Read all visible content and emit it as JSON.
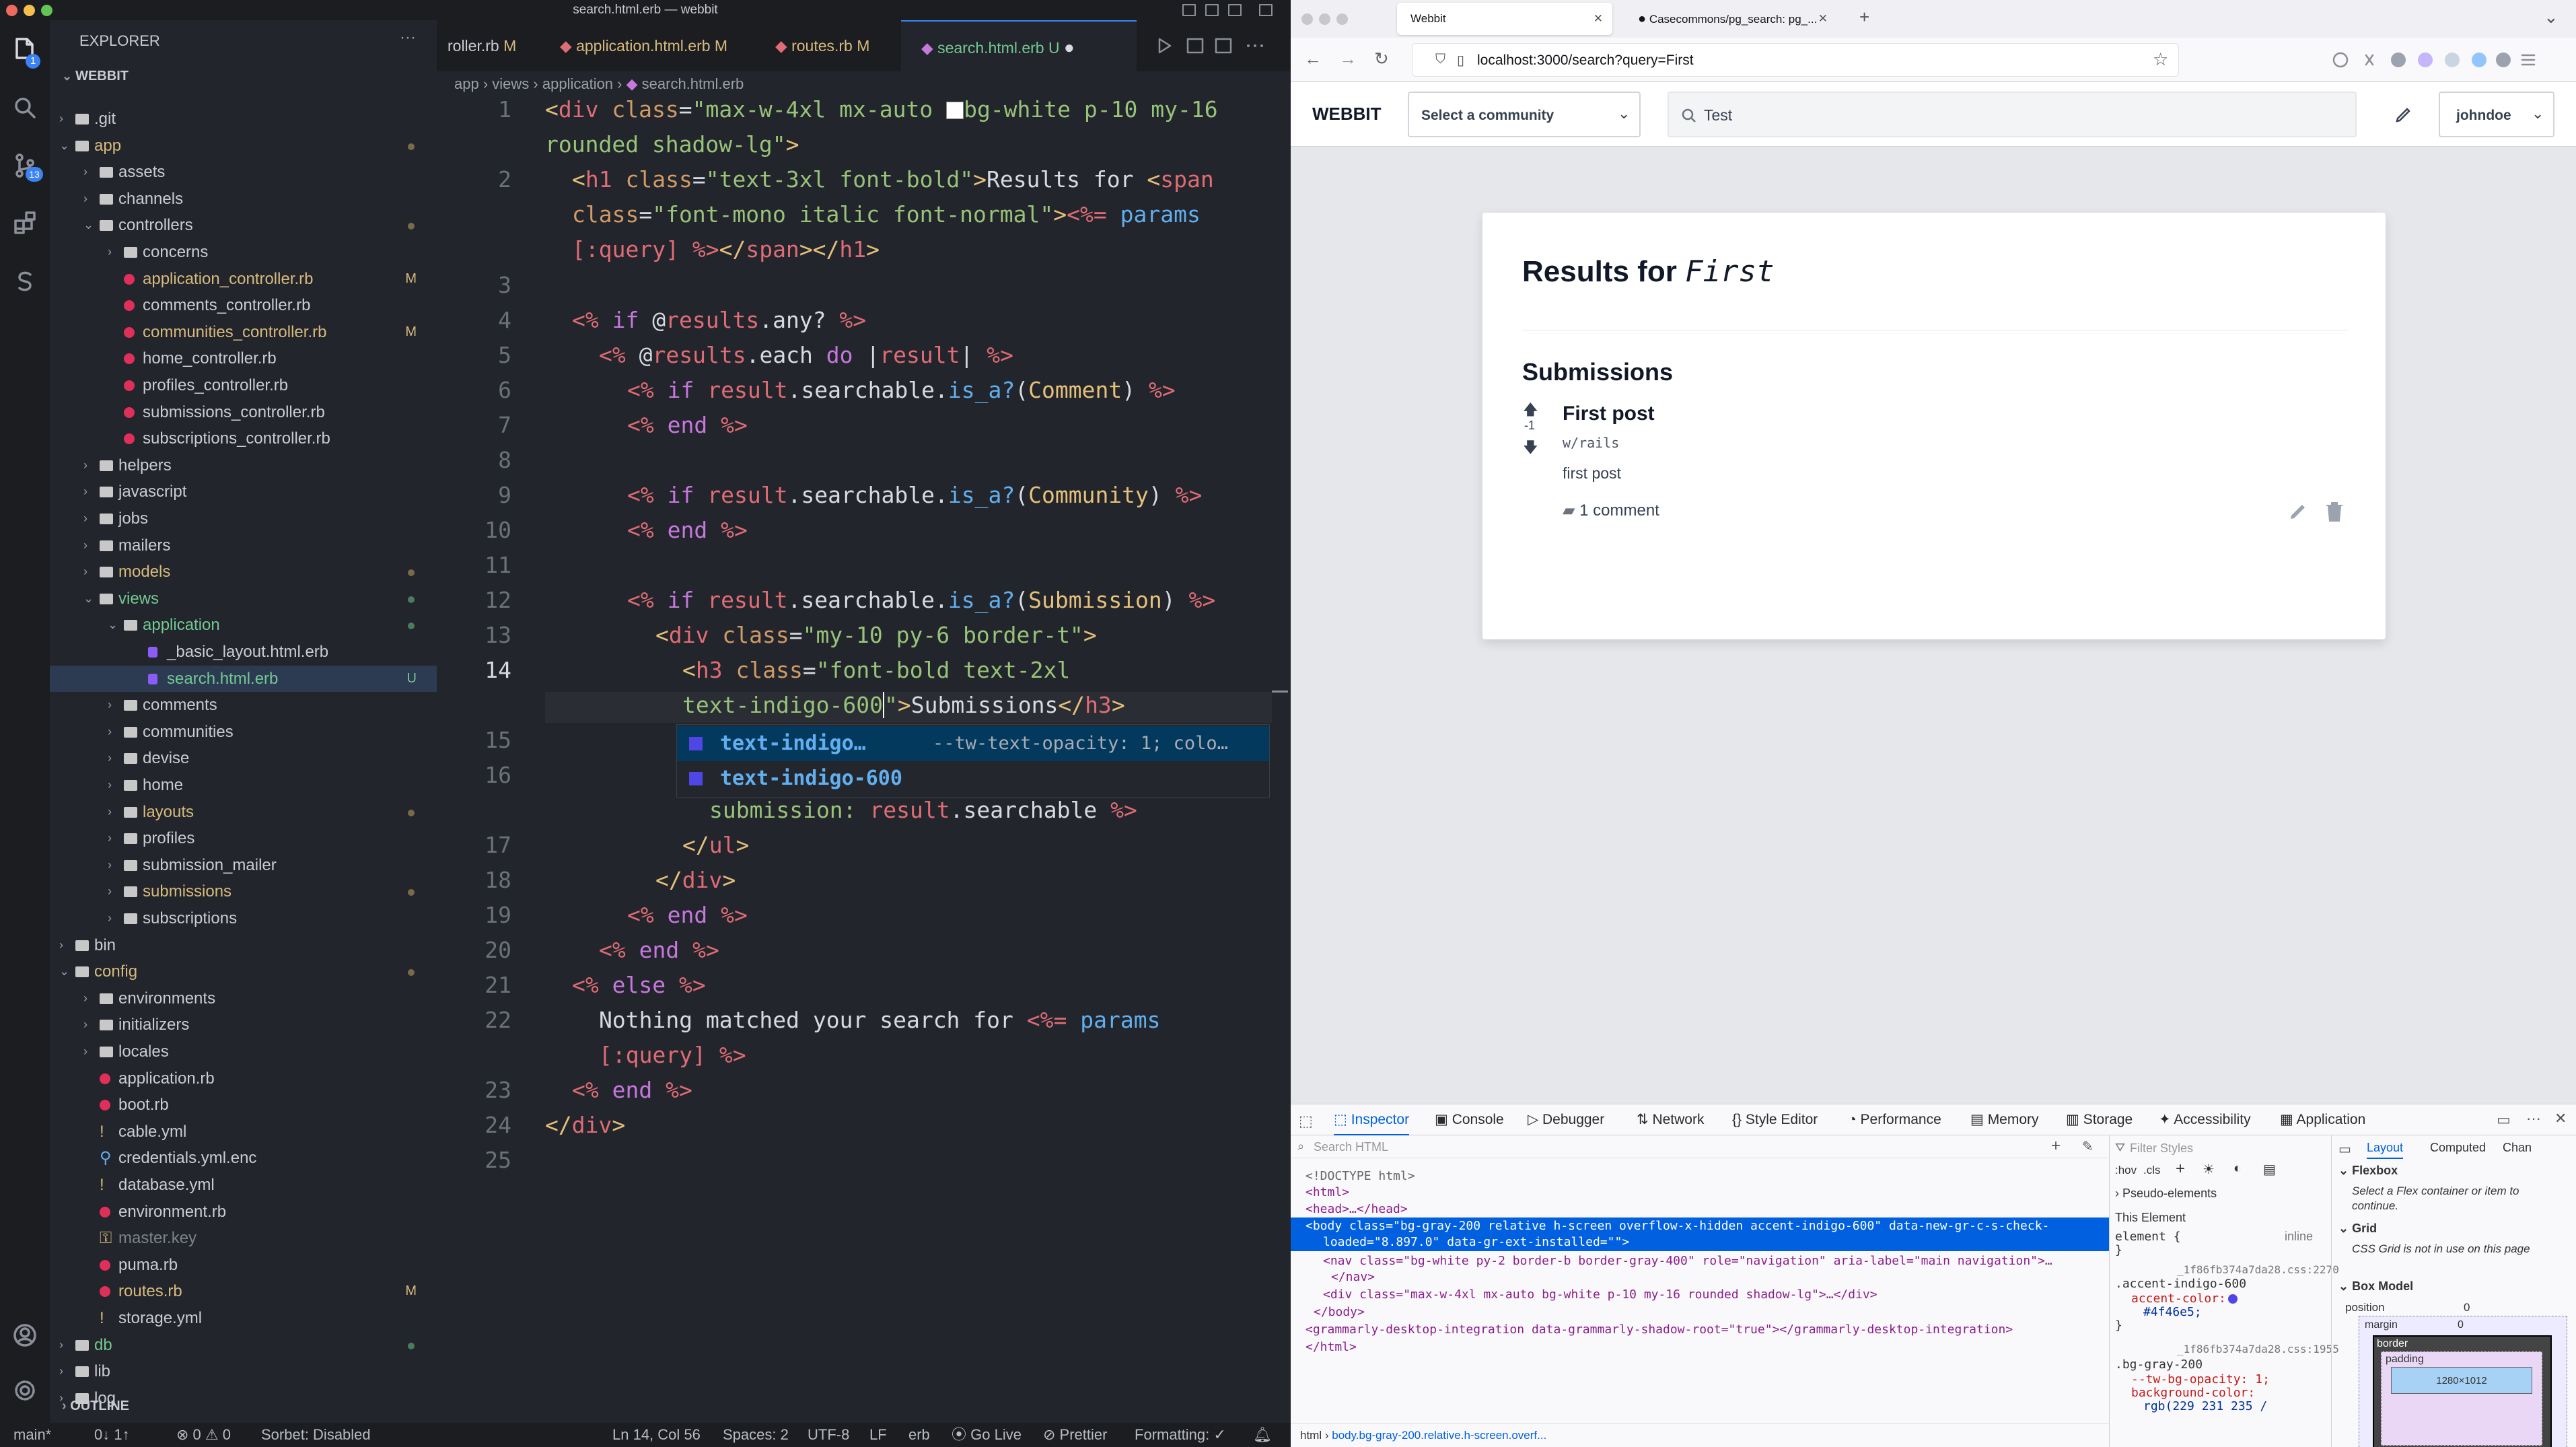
{
  "vscode": {
    "window_title": "search.html.erb — webbit",
    "explorer_title": "EXPLORER",
    "project": "WEBBIT",
    "scm_badge": "1",
    "ext_badge": "13",
    "tabs": [
      {
        "label": "roller.rb",
        "badge": "M"
      },
      {
        "label": "application.html.erb",
        "badge": "M"
      },
      {
        "label": "routes.rb",
        "badge": "M"
      },
      {
        "label": "search.html.erb",
        "badge": "U"
      }
    ],
    "breadcrumb": [
      "app",
      "views",
      "application",
      "search.html.erb"
    ],
    "tree": [
      {
        "label": ".git"
      },
      {
        "label": "app"
      },
      {
        "label": "assets"
      },
      {
        "label": "channels"
      },
      {
        "label": "controllers"
      },
      {
        "label": "concerns"
      },
      {
        "label": "application_controller.rb",
        "badge": "M"
      },
      {
        "label": "comments_controller.rb"
      },
      {
        "label": "communities_controller.rb",
        "badge": "M"
      },
      {
        "label": "home_controller.rb"
      },
      {
        "label": "profiles_controller.rb"
      },
      {
        "label": "submissions_controller.rb"
      },
      {
        "label": "subscriptions_controller.rb"
      },
      {
        "label": "helpers"
      },
      {
        "label": "javascript"
      },
      {
        "label": "jobs"
      },
      {
        "label": "mailers"
      },
      {
        "label": "models"
      },
      {
        "label": "views"
      },
      {
        "label": "application"
      },
      {
        "label": "_basic_layout.html.erb"
      },
      {
        "label": "search.html.erb",
        "badge": "U"
      },
      {
        "label": "comments"
      },
      {
        "label": "communities"
      },
      {
        "label": "devise"
      },
      {
        "label": "home"
      },
      {
        "label": "layouts"
      },
      {
        "label": "profiles"
      },
      {
        "label": "submission_mailer"
      },
      {
        "label": "submissions"
      },
      {
        "label": "subscriptions"
      },
      {
        "label": "bin"
      },
      {
        "label": "config"
      },
      {
        "label": "environments"
      },
      {
        "label": "initializers"
      },
      {
        "label": "locales"
      },
      {
        "label": "application.rb"
      },
      {
        "label": "boot.rb"
      },
      {
        "label": "cable.yml"
      },
      {
        "label": "credentials.yml.enc"
      },
      {
        "label": "database.yml"
      },
      {
        "label": "environment.rb"
      },
      {
        "label": "master.key"
      },
      {
        "label": "puma.rb"
      },
      {
        "label": "routes.rb",
        "badge": "M"
      },
      {
        "label": "storage.yml"
      },
      {
        "label": "db"
      },
      {
        "label": "lib"
      },
      {
        "label": "log"
      }
    ],
    "outline": "OUTLINE",
    "line_numbers": [
      "1",
      "2",
      "3",
      "4",
      "5",
      "6",
      "7",
      "8",
      "9",
      "10",
      "11",
      "12",
      "13",
      "14",
      "15",
      "16",
      "17",
      "18",
      "19",
      "20",
      "21",
      "22",
      "23",
      "24",
      "25"
    ],
    "suggest": {
      "item1": "text-indigo…",
      "item1_detail": "--tw-text-opacity: 1; colo…",
      "item2": "text-indigo-600"
    },
    "status": {
      "branch": "main*",
      "sync": "0↓ 1↑",
      "problems": "⊗ 0 ⚠ 0",
      "sorbet": "Sorbet: Disabled",
      "position": "Ln 14, Col 56",
      "spaces": "Spaces: 2",
      "encoding": "UTF-8",
      "eol": "LF",
      "lang": "erb",
      "golive": "Go Live",
      "prettier": "Prettier",
      "formatting": "Formatting: ✓"
    }
  },
  "browser": {
    "tabs": [
      {
        "label": "Webbit"
      },
      {
        "label": "Casecommons/pg_search: pg_..."
      }
    ],
    "url": "localhost:3000/search?query=First",
    "page": {
      "brand": "WEBBIT",
      "community_select": "Select a community",
      "search_value": "Test",
      "user": "johndoe",
      "results_prefix": "Results for",
      "query": "First",
      "section": "Submissions",
      "vote_count": "-1",
      "post_title": "First post",
      "community": "w/rails",
      "post_body": "first post",
      "comments": "1 comment"
    },
    "devtools": {
      "tabs": [
        "Inspector",
        "Console",
        "Debugger",
        "Network",
        "Style Editor",
        "Performance",
        "Memory",
        "Storage",
        "Accessibility",
        "Application"
      ],
      "search_placeholder": "Search HTML",
      "filter_placeholder": "Filter Styles",
      "html_lines": [
        "<!DOCTYPE html>",
        "<html>",
        "<head>…</head>",
        "<body class=\"bg-gray-200 relative h-screen overflow-x-hidden accent-indigo-600\" data-new-gr-c-s-check-",
        "loaded=\"8.897.0\" data-gr-ext-installed=\"\">",
        "<nav class=\"bg-white py-2 border-b border-gray-400\" role=\"navigation\" aria-label=\"main navigation\">…",
        "</nav>",
        "<div class=\"max-w-4xl mx-auto bg-white p-10 my-16 rounded shadow-lg\">…</div>",
        "</body>",
        "<grammarly-desktop-integration data-grammarly-shadow-root=\"true\"></grammarly-desktop-integration>",
        "</html>"
      ],
      "rules_toolbar": [
        ":hov",
        ".cls"
      ],
      "rules": {
        "pseudo": "Pseudo-elements",
        "this_element": "This Element",
        "element_rule": "element {",
        "inline": "inline",
        "close": "}",
        "src1": "_1f86fb374a7da28.css:2270",
        "rule1_sel": ".accent-indigo-600",
        "rule1_prop": "accent-color:",
        "rule1_val": "#4f46e5;",
        "src2": "_1f86fb374a7da28.css:1955",
        "rule2_sel": ".bg-gray-200",
        "rule2_prop1": "--tw-bg-opacity: 1;",
        "rule2_prop2": "background-color:",
        "rule2_val2": "rgb(229 231 235 /"
      },
      "layout_tabs": [
        "Layout",
        "Computed",
        "Chan"
      ],
      "layout": {
        "flexbox": "Flexbox",
        "flex_hint": "Select a Flex container or item to continue.",
        "grid": "Grid",
        "grid_hint": "CSS Grid is not in use on this page",
        "box_model": "Box Model",
        "position": "position",
        "zero": "0",
        "margin": "margin",
        "border": "border",
        "padding": "padding",
        "size": "1280×1012"
      },
      "path": [
        "html",
        "body.bg-gray-200.relative.h-screen.overf..."
      ]
    }
  }
}
